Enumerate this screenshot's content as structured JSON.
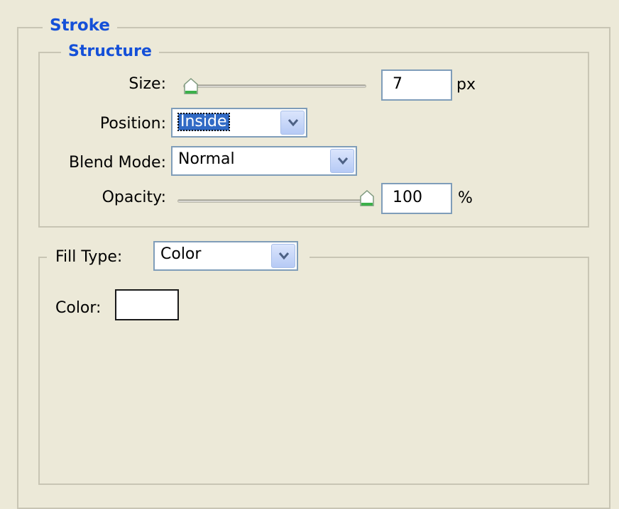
{
  "stroke": {
    "title": "Stroke",
    "structure": {
      "title": "Structure",
      "size": {
        "label": "Size:",
        "value": "7",
        "unit": "px",
        "slider_fraction": 0.0
      },
      "position": {
        "label": "Position:",
        "value": "Inside"
      },
      "blend_mode": {
        "label": "Blend Mode:",
        "value": "Normal"
      },
      "opacity": {
        "label": "Opacity:",
        "value": "100",
        "unit": "%",
        "slider_fraction": 1.0
      }
    },
    "fill": {
      "type_label": "Fill Type:",
      "type_value": "Color",
      "color_label": "Color:",
      "color_value": "#ffffff"
    }
  },
  "colors": {
    "panel_background": "#ece9d8",
    "legend_text": "#1550d8",
    "input_border": "#7f9db9",
    "selection_highlight": "#316ac5",
    "slider_thumb_accent": "#3cb04a"
  }
}
